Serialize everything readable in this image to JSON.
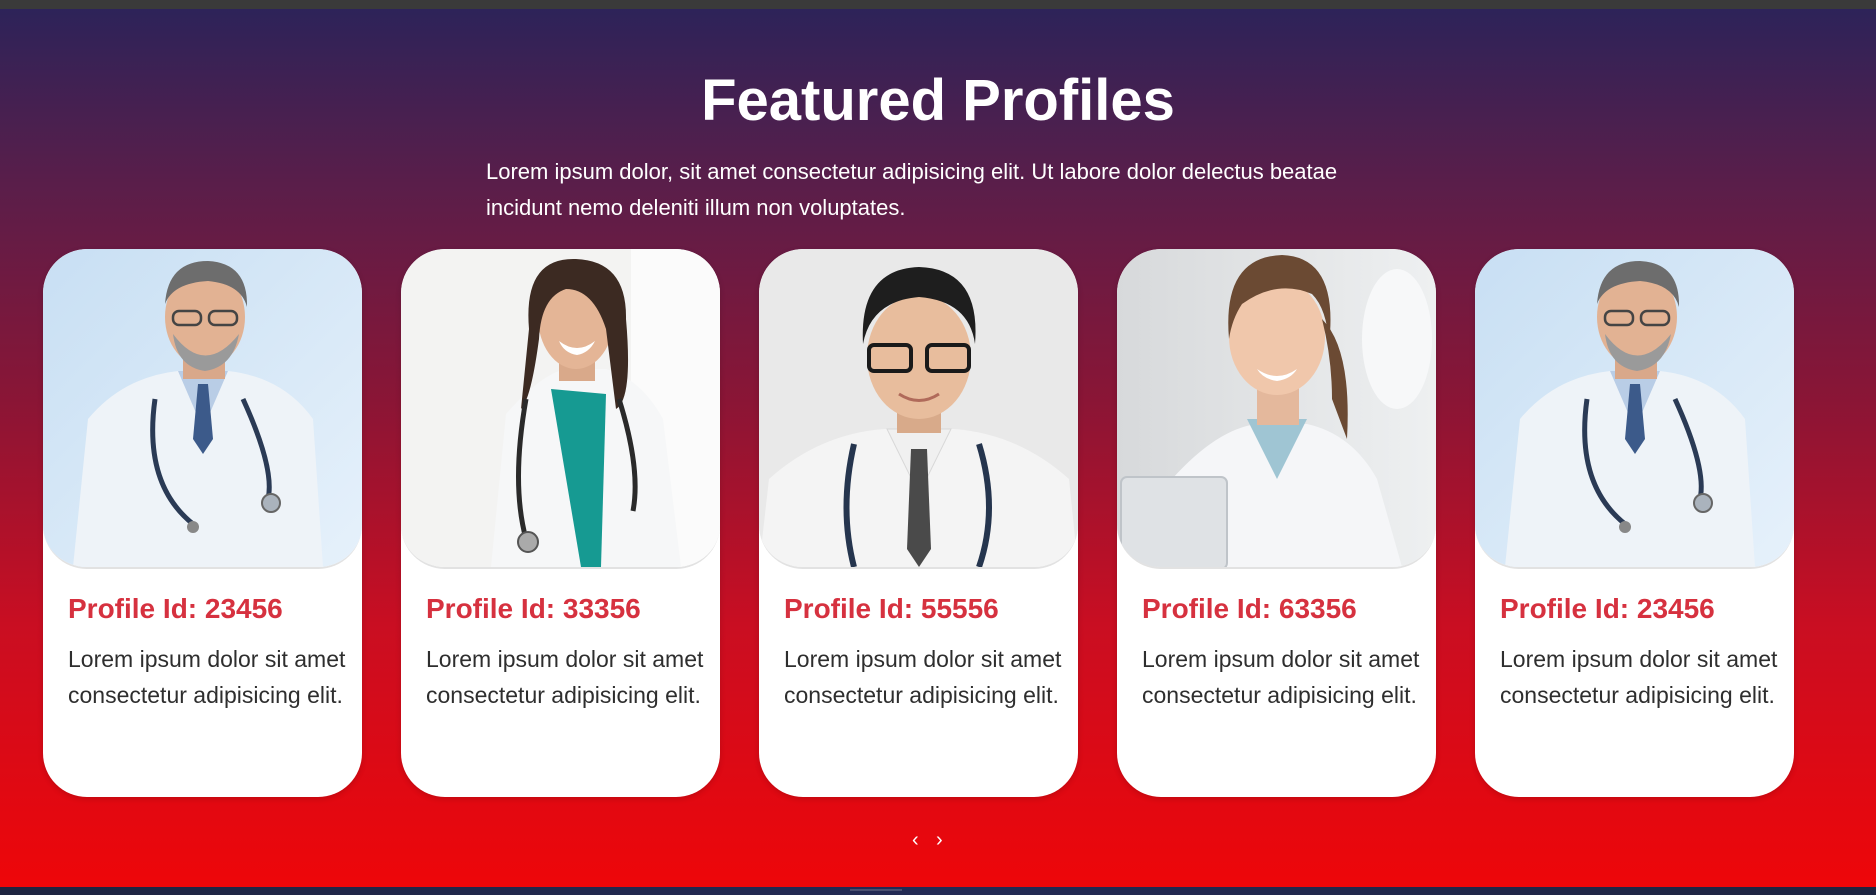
{
  "section": {
    "title": "Featured Profiles",
    "subtitle": "Lorem ipsum dolor, sit amet consectetur adipisicing elit. Ut labore dolor delectus beatae incidunt nemo deleniti illum non voluptates."
  },
  "profiles": [
    {
      "id_label": "Profile Id: 23456",
      "description": "Lorem ipsum dolor sit amet consectetur adipisicing elit.",
      "photo": "doctor-man-glasses-beard"
    },
    {
      "id_label": "Profile Id: 33356",
      "description": "Lorem ipsum dolor sit amet consectetur adipisicing elit.",
      "photo": "doctor-woman-dark-hair"
    },
    {
      "id_label": "Profile Id: 55556",
      "description": "Lorem ipsum dolor sit amet consectetur adipisicing elit.",
      "photo": "doctor-young-man-glasses"
    },
    {
      "id_label": "Profile Id: 63356",
      "description": "Lorem ipsum dolor sit amet consectetur adipisicing elit.",
      "photo": "doctor-woman-ponytail-laptop"
    },
    {
      "id_label": "Profile Id: 23456",
      "description": "Lorem ipsum dolor sit amet consectetur adipisicing elit.",
      "photo": "doctor-man-glasses-beard"
    }
  ],
  "carousel": {
    "prev_label": "‹",
    "next_label": "›"
  },
  "colors": {
    "accent": "#d6313f",
    "gradient_top": "#2d2359",
    "gradient_bottom": "#ee0609"
  }
}
